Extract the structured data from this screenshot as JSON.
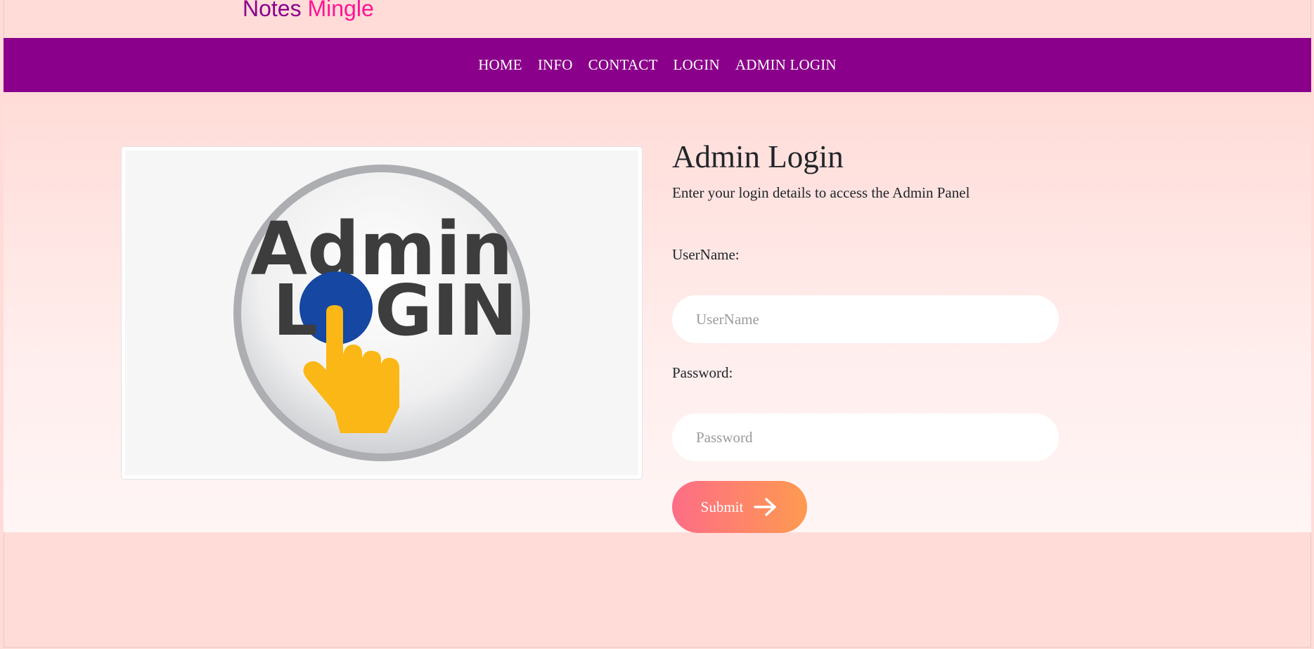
{
  "brand": {
    "part1": "Notes",
    "part2": "Mingle"
  },
  "nav": {
    "items": [
      {
        "label": "HOME"
      },
      {
        "label": "INFO"
      },
      {
        "label": "CONTACT"
      },
      {
        "label": "LOGIN"
      },
      {
        "label": "ADMIN LOGIN"
      }
    ]
  },
  "image": {
    "line1": "Admin",
    "line2_pre": "L",
    "line2_post": "GIN",
    "icon": "admin-login-hand-icon"
  },
  "form": {
    "title": "Admin Login",
    "subtitle": "Enter your login details to access the Admin Panel",
    "username_label": "UserName:",
    "username_placeholder": "UserName",
    "username_value": "",
    "password_label": "Password:",
    "password_placeholder": "Password",
    "password_value": "",
    "submit_label": "Submit",
    "submit_icon": "arrow-right-icon"
  },
  "colors": {
    "nav_bg": "#8b008b",
    "brand_primary": "#8b008b",
    "brand_accent": "#ff1493",
    "button_start": "#fd6d86",
    "button_end": "#fe9a50",
    "page_bg": "#ffdcd8"
  }
}
